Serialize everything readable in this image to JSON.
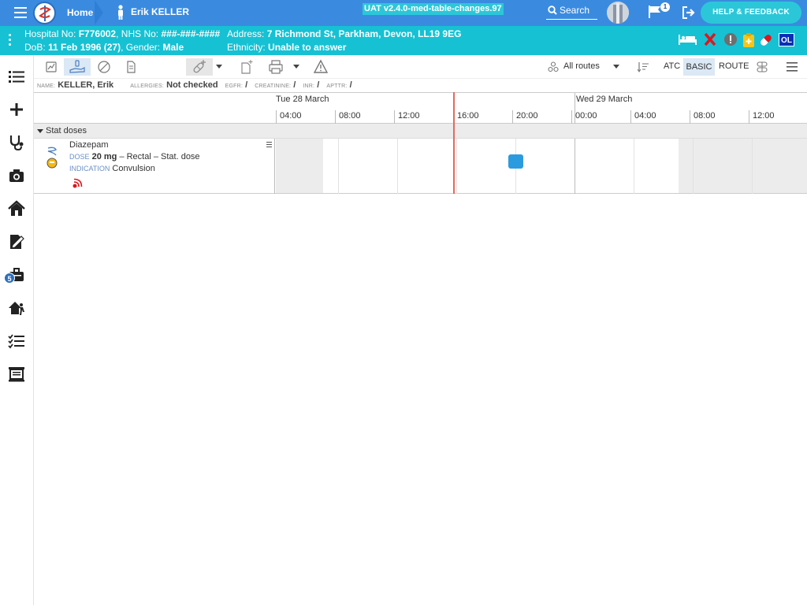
{
  "topbar": {
    "home_label": "Home",
    "patient_label": "Erik KELLER",
    "version": "UAT v2.4.0-med-table-changes.97",
    "search_label": "Search",
    "flag_count": "1",
    "help_label": "HELP & FEEDBACK"
  },
  "banner": {
    "hospital_label": "Hospital No:",
    "hospital_no": "F776002",
    "nhs_label": "NHS No:",
    "nhs_no": "###-###-####",
    "address_label": "Address:",
    "address": "7 Richmond St, Parkham, Devon, LL19 9EG",
    "dob_label": "DoB:",
    "dob": "11 Feb 1996 (27)",
    "gender_label": "Gender:",
    "gender": "Male",
    "ethnicity_label": "Ethnicity:",
    "ethnicity": "Unable to answer",
    "ol_badge": "OL"
  },
  "sidebar": {
    "badge_count": "5"
  },
  "toolbar": {
    "routes_label": "All routes",
    "atc_label": "ATC",
    "basic_label": "BASIC",
    "route_label": "ROUTE"
  },
  "infoline": {
    "name_label": "NAME:",
    "name": "KELLER, Erik",
    "allergies_label": "ALLERGIES:",
    "allergies": "Not checked",
    "egfr_label": "EGFR:",
    "egfr": "/",
    "creatinine_label": "CREATININE:",
    "creatinine": "/",
    "inr_label": "INR:",
    "inr": "/",
    "aptt_label": "APTTR:",
    "aptt": "/"
  },
  "timeline": {
    "day1": "Tue 28 March",
    "day2": "Wed 29 March",
    "hours": [
      "04:00",
      "08:00",
      "12:00",
      "16:00",
      "20:00",
      "00:00",
      "04:00",
      "08:00",
      "12:00"
    ]
  },
  "section": {
    "title": "Stat doses"
  },
  "drug": {
    "name": "Diazepam",
    "dose_label": "DOSE",
    "dose": "20 mg",
    "dose_rest": "– Rectal – Stat. dose",
    "indication_label": "INDICATION",
    "indication": "Convulsion"
  },
  "colors": {
    "topbar": "#3a8be0",
    "banner": "#16c1d3",
    "help_button": "#2bc7d9",
    "now_line": "#e46a5b",
    "dose_marker": "#2b9be0"
  }
}
